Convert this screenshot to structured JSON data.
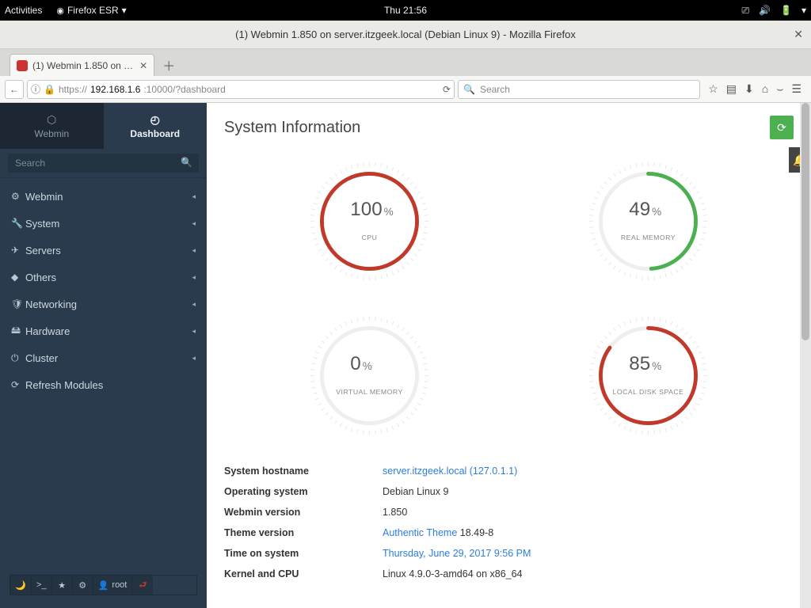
{
  "gnome": {
    "activities": "Activities",
    "browser": "Firefox ESR",
    "clock": "Thu 21:56"
  },
  "window_title": "(1) Webmin 1.850 on server.itzgeek.local (Debian Linux 9) - Mozilla Firefox",
  "tab_title": "(1) Webmin 1.850 on …",
  "url": {
    "proto": "https://",
    "host": "192.168.1.6",
    "path": ":10000/?dashboard"
  },
  "search_placeholder": "Search",
  "side_tabs": {
    "webmin": "Webmin",
    "dashboard": "Dashboard"
  },
  "side_search_placeholder": "Search",
  "nav": [
    {
      "icon": "⚙",
      "label": "Webmin"
    },
    {
      "icon": "🔧",
      "label": "System"
    },
    {
      "icon": "✈",
      "label": "Servers"
    },
    {
      "icon": "◆",
      "label": "Others"
    },
    {
      "icon": "🛡",
      "label": "Networking"
    },
    {
      "icon": "🖴",
      "label": "Hardware"
    },
    {
      "icon": "⏻",
      "label": "Cluster"
    },
    {
      "icon": "⟳",
      "label": "Refresh Modules"
    }
  ],
  "footer_user": "root",
  "page_title": "System Information",
  "notif_count": "1",
  "chart_data": [
    {
      "type": "gauge",
      "label": "CPU",
      "value": 100,
      "unit": "%",
      "color": "#c0392b"
    },
    {
      "type": "gauge",
      "label": "REAL MEMORY",
      "value": 49,
      "unit": "%",
      "color": "#4caf50"
    },
    {
      "type": "gauge",
      "label": "VIRTUAL MEMORY",
      "value": 0,
      "unit": "%",
      "color": "#eeeeee"
    },
    {
      "type": "gauge",
      "label": "LOCAL DISK SPACE",
      "value": 85,
      "unit": "%",
      "color": "#c0392b"
    }
  ],
  "info": [
    {
      "k": "System hostname",
      "link": "server.itzgeek.local (127.0.1.1)"
    },
    {
      "k": "Operating system",
      "v": "Debian Linux 9"
    },
    {
      "k": "Webmin version",
      "v": "1.850"
    },
    {
      "k": "Theme version",
      "link": "Authentic Theme",
      "suffix": " 18.49-8"
    },
    {
      "k": "Time on system",
      "link": "Thursday, June 29, 2017 9:56 PM"
    },
    {
      "k": "Kernel and CPU",
      "v": "Linux 4.9.0-3-amd64 on x86_64"
    }
  ]
}
